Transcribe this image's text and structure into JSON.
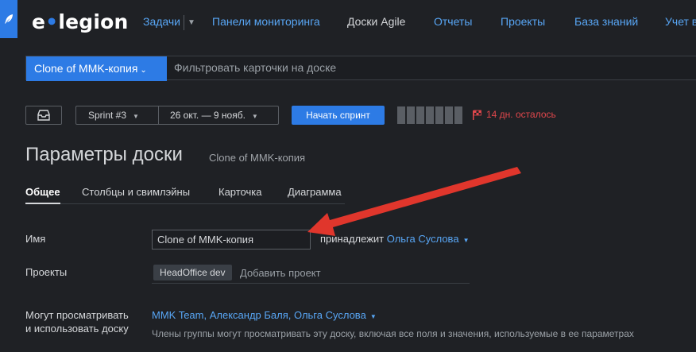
{
  "brand": {
    "name_prefix": "e",
    "name_suffix": "legion"
  },
  "nav": [
    {
      "label": "Задачи"
    },
    {
      "label": "Панели мониторинга"
    },
    {
      "label": "Доски Agile"
    },
    {
      "label": "Отчеты"
    },
    {
      "label": "Проекты"
    },
    {
      "label": "База знаний"
    },
    {
      "label": "Учет в"
    }
  ],
  "filter": {
    "board_label": "Clone of MMK-копия",
    "placeholder": "Фильтровать карточки на доске"
  },
  "toolbar": {
    "sprint": "Sprint #3",
    "dates": "26 окт. — 9 нояб.",
    "start_label": "Начать спринт",
    "remaining": "14 дн. осталось",
    "progress_segments": 7
  },
  "page": {
    "title": "Параметры доски",
    "subtitle": "Clone of MMK-копия"
  },
  "tabs": [
    {
      "label": "Общее"
    },
    {
      "label": "Столбцы и свимлэйны"
    },
    {
      "label": "Карточка"
    },
    {
      "label": "Диаграмма"
    }
  ],
  "form": {
    "name_label": "Имя",
    "name_value": "Clone of MMK-копия",
    "owner_prefix": "принадлежит",
    "owner_name": "Ольга Суслова",
    "projects_label": "Проекты",
    "project_tag": "HeadOffice dev",
    "add_project": "Добавить проект",
    "viewers_label_1": "Могут просматривать",
    "viewers_label_2": "и использовать доску",
    "viewers_value": "MMK Team, Александр Баля, Ольга Суслова",
    "viewers_hint": "Члены группы могут просматривать эту доску, включая все поля и значения, используемые в ее параметрах"
  },
  "colors": {
    "accent": "#2d7be5",
    "link": "#58a6f5",
    "background": "#1f2125",
    "warning": "#e0474c",
    "arrow": "#e0362c"
  }
}
